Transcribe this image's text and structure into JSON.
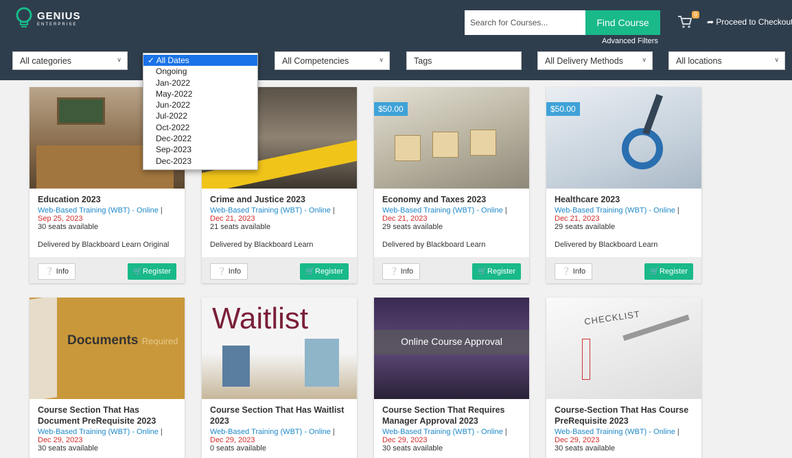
{
  "header": {
    "logo_line1": "GENIUS",
    "logo_line2": "ENTERPRISE",
    "search_placeholder": "Search for Courses...",
    "find_button": "Find Course",
    "advanced_filters": "Advanced Filters",
    "cart_count": "0",
    "checkout": "Proceed to Checkout"
  },
  "filters": {
    "categories": "All categories",
    "competencies": "All Competencies",
    "tags": "Tags",
    "delivery": "All Delivery Methods",
    "locations": "All locations"
  },
  "date_dropdown": {
    "selected": "✓ All Dates",
    "options": [
      "Ongoing",
      "Jan-2022",
      "May-2022",
      "Jun-2022",
      "Jul-2022",
      "Oct-2022",
      "Dec-2022",
      "Sep-2023",
      "Dec-2023"
    ]
  },
  "cards": [
    {
      "title": "Education 2023",
      "method": "Web-Based Training (WBT) - Online",
      "date": "Sep 25, 2023",
      "seats": "30 seats available",
      "delivered": "Delivered by Blackboard Learn Original",
      "price": "",
      "info": "Info",
      "register": "Register"
    },
    {
      "title": "Crime and Justice 2023",
      "method": "Web-Based Training (WBT) - Online",
      "date": "Dec 21, 2023",
      "seats": "21 seats available",
      "delivered": "Delivered by Blackboard Learn",
      "price": "",
      "info": "Info",
      "register": "Register"
    },
    {
      "title": "Economy and Taxes 2023",
      "method": "Web-Based Training (WBT) - Online",
      "date": "Dec 21, 2023",
      "seats": "29 seats available",
      "delivered": "Delivered by Blackboard Learn",
      "price": "$50.00",
      "info": "Info",
      "register": "Register"
    },
    {
      "title": "Healthcare 2023",
      "method": "Web-Based Training (WBT) - Online",
      "date": "Dec 21, 2023",
      "seats": "29 seats available",
      "delivered": "Delivered by Blackboard Learn",
      "price": "$50.00",
      "info": "Info",
      "register": "Register"
    },
    {
      "title": "Course Section That Has Document PreRequisite 2023",
      "method": "Web-Based Training (WBT) - Online",
      "date": "Dec 29, 2023",
      "seats": "30 seats available",
      "thumb_text": "Documents",
      "thumb_sub": "Required"
    },
    {
      "title": "Course Section That Has Waitlist 2023",
      "method": "Web-Based Training (WBT) - Online",
      "date": "Dec 29, 2023",
      "seats": "0 seats available",
      "thumb_text": "Waitlist"
    },
    {
      "title": "Course Section That Requires Manager Approval 2023",
      "method": "Web-Based Training (WBT) - Online",
      "date": "Dec 29, 2023",
      "seats": "30 seats available",
      "thumb_text": "Online Course Approval"
    },
    {
      "title": "Course-Section That Has Course PreRequisite 2023",
      "method": "Web-Based Training (WBT) - Online",
      "date": "Dec 29, 2023",
      "seats": "30 seats available",
      "thumb_text": "CHECKLIST"
    }
  ],
  "colors": {
    "header_bg": "#2f3e4d",
    "accent_green": "#19b98a",
    "link_blue": "#1e88c8",
    "date_red": "#d62b2b",
    "price_blue": "#3fa2d8"
  }
}
